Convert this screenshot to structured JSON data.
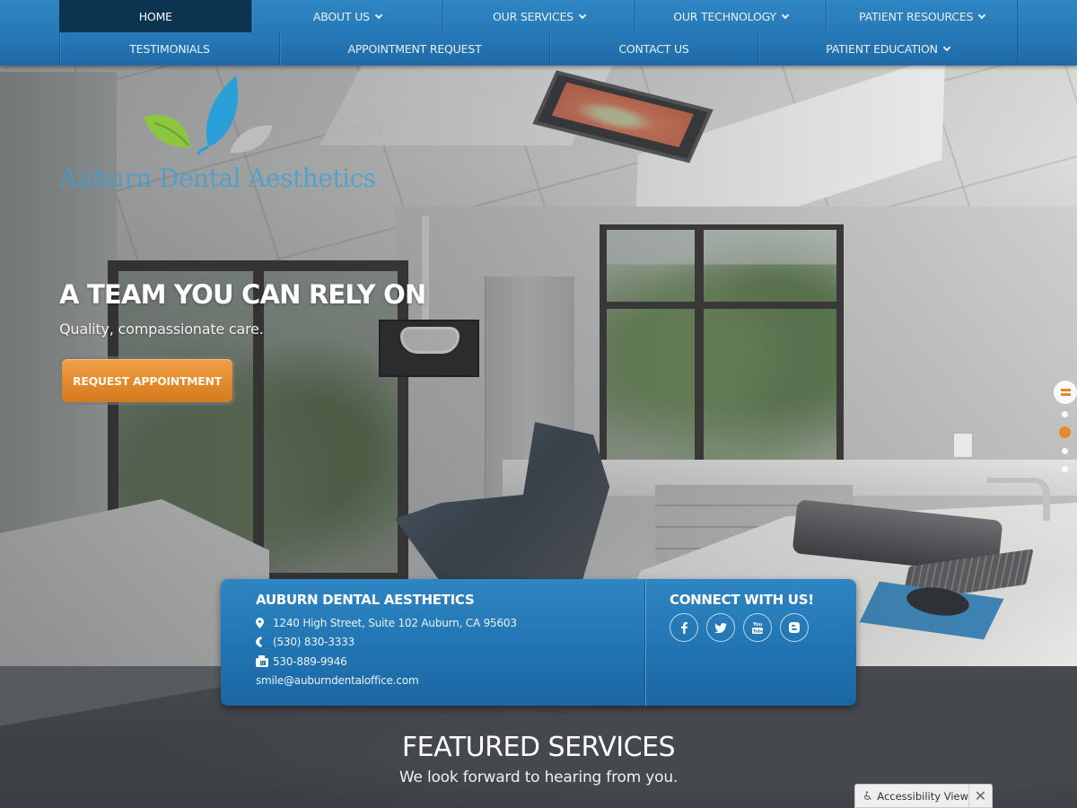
{
  "nav": {
    "row1": [
      {
        "label": "HOME",
        "active": true,
        "dropdown": false
      },
      {
        "label": "ABOUT US",
        "active": false,
        "dropdown": true
      },
      {
        "label": "OUR SERVICES",
        "active": false,
        "dropdown": true
      },
      {
        "label": "OUR TECHNOLOGY",
        "active": false,
        "dropdown": true
      },
      {
        "label": "PATIENT RESOURCES",
        "active": false,
        "dropdown": true
      }
    ],
    "row2": [
      {
        "label": "TESTIMONIALS",
        "dropdown": false
      },
      {
        "label": "APPOINTMENT REQUEST",
        "dropdown": false
      },
      {
        "label": "CONTACT US",
        "dropdown": false
      },
      {
        "label": "PATIENT EDUCATION",
        "dropdown": true
      }
    ]
  },
  "logo": {
    "text": "Auburn Dental Aesthetics",
    "leaf_colors": [
      "#8cc63f",
      "#2a9fd8",
      "#bdbdbd"
    ]
  },
  "hero": {
    "title": "A TEAM YOU CAN RELY ON",
    "subtitle": "Quality, compassionate care.",
    "cta_label": "REQUEST APPOINTMENT"
  },
  "slider": {
    "pause_icon": "pause-icon",
    "slide_count": 4,
    "active_slide": 2
  },
  "info": {
    "title": "AUBURN DENTAL AESTHETICS",
    "address": "1240 High Street, Suite 102 Auburn, CA 95603",
    "phone": "(530) 830-3333",
    "fax": "530-889-9946",
    "email": "smile@auburndentaloffice.com",
    "connect_title": "CONNECT WITH US!",
    "socials": [
      {
        "name": "facebook",
        "glyph": "f"
      },
      {
        "name": "twitter",
        "glyph": "t"
      },
      {
        "name": "youtube",
        "glyph": "You Tube"
      },
      {
        "name": "blogger",
        "glyph": "B"
      }
    ]
  },
  "featured": {
    "title": "FEATURED SERVICES",
    "subtitle": "We look forward to hearing from you."
  },
  "accessibility": {
    "label": "Accessibility View",
    "close": "✕"
  },
  "colors": {
    "nav_blue": "#2577b5",
    "nav_active": "#0c3350",
    "accent_orange": "#e38a2a",
    "info_blue": "#2174b2"
  }
}
